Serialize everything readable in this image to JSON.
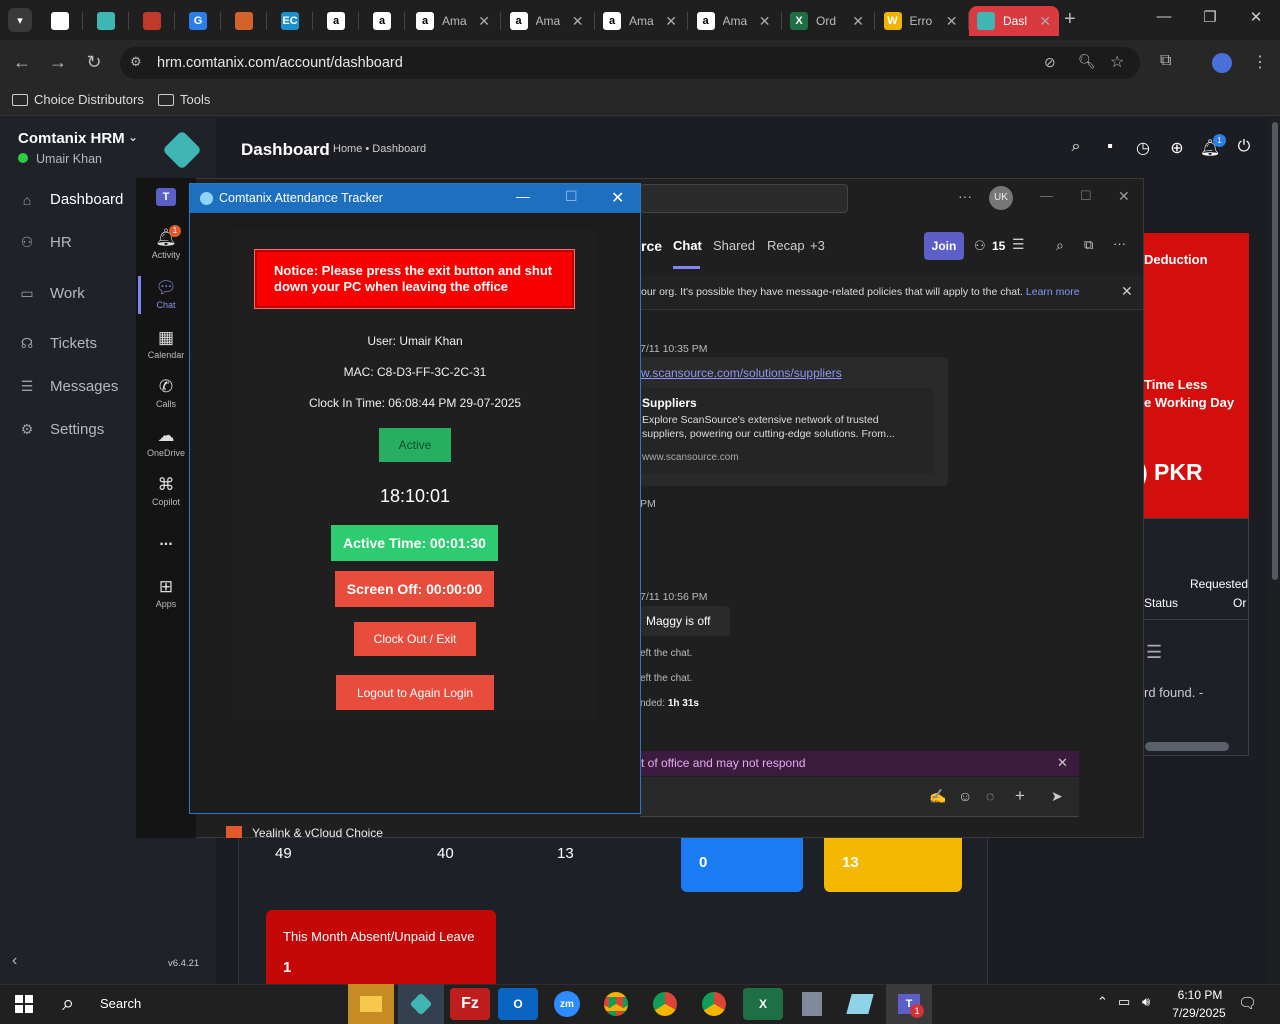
{
  "browser": {
    "tabs": [
      {
        "title": "",
        "icon": "circle-logo-icon",
        "color": "#ffffff"
      },
      {
        "title": "",
        "icon": "comtanix-icon",
        "color": "#3fb6b3"
      },
      {
        "title": "",
        "icon": "d-and-h-icon",
        "color": "#c0392b"
      },
      {
        "title": "",
        "icon": "g-logo-icon",
        "color": "#2b7de9"
      },
      {
        "title": "",
        "icon": "box-icon",
        "color": "#d4622b"
      },
      {
        "title": "",
        "icon": "ec-icon",
        "color": "#1e90c8"
      },
      {
        "title": "",
        "icon": "amazon-icon",
        "color": "#ffffff"
      },
      {
        "title": "",
        "icon": "amazon-icon",
        "color": "#ffffff"
      },
      {
        "title": "Ama",
        "icon": "amazon-icon",
        "color": "#ffffff"
      },
      {
        "title": "Ama",
        "icon": "amazon-icon",
        "color": "#ffffff"
      },
      {
        "title": "Ama",
        "icon": "amazon-icon",
        "color": "#ffffff"
      },
      {
        "title": "Ama",
        "icon": "amazon-icon",
        "color": "#ffffff"
      },
      {
        "title": "Ord",
        "icon": "excel-icon",
        "color": "#1d7044"
      },
      {
        "title": "Erro",
        "icon": "w-icon",
        "color": "#f0b400"
      },
      {
        "title": "Dasl",
        "icon": "comtanix-icon",
        "color": "#3fb6b3"
      }
    ],
    "url": "hrm.comtanix.com/account/dashboard",
    "bookmarks": [
      "Choice Distributors",
      "Tools"
    ]
  },
  "hrm": {
    "org": "Comtanix HRM",
    "user": "Umair Khan",
    "nav": [
      "Dashboard",
      "HR",
      "Work",
      "Tickets",
      "Messages",
      "Settings"
    ],
    "page_title": "Dashboard",
    "breadcrumb": "Home • Dashboard",
    "notification_count": "1",
    "version": "v6.4.21",
    "deduction_label": "Deduction",
    "time_less_label": "Time Less",
    "working_day_label": "e Working Day",
    "pkr_value": ") PKR",
    "table_head_requested": "Requested",
    "table_head_status": "Status",
    "table_head_or": "Or",
    "no_record": "rd found. -",
    "stats": [
      "49",
      "40",
      "13"
    ],
    "blue_card_value": "0",
    "yellow_card_value": "13",
    "absent_title": "This Month Absent/Unpaid Leave",
    "absent_value": "1"
  },
  "teams": {
    "rail": [
      {
        "label": "Activity",
        "icon": "bell-icon",
        "badge": "1"
      },
      {
        "label": "Chat",
        "icon": "chat-icon"
      },
      {
        "label": "Calendar",
        "icon": "calendar-icon"
      },
      {
        "label": "Calls",
        "icon": "phone-icon"
      },
      {
        "label": "OneDrive",
        "icon": "cloud-icon"
      },
      {
        "label": "Copilot",
        "icon": "copilot-icon"
      },
      {
        "label": "...",
        "icon": "more-icon"
      },
      {
        "label": "Apps",
        "icon": "apps-icon"
      }
    ],
    "chat_name_partial": "rce",
    "tabs": [
      "Chat",
      "Shared",
      "Recap",
      "+3"
    ],
    "join_label": "Join",
    "participants": "15",
    "avatar_initials": "UK",
    "banner_text": "our org. It's possible they have message-related policies that will apply to the chat.",
    "banner_link": "Learn more",
    "msg1_time": "7/11 10:35 PM",
    "msg1_link": "w.scansource.com/solutions/suppliers",
    "card_title": "Suppliers",
    "card_desc": "Explore ScanSource's extensive network of trusted suppliers, powering our cutting-edge solutions. From...",
    "card_domain": "www.scansource.com",
    "pm_label": "PM",
    "msg2_time": "7/11 10:56 PM",
    "msg2_text": "Maggy is off",
    "left1": "eft the chat.",
    "left2": "eft the chat.",
    "ended_prefix": "nded:",
    "ended_value": "1h 31s",
    "ooo_text": "t of office and may not respond",
    "sidebar_item": "Yealink & vCloud Choice"
  },
  "tracker": {
    "title": "Comtanix Attendance Tracker",
    "notice": "Notice: Please press the exit button and shut down your PC when leaving the office",
    "user_line": "User: Umair Khan",
    "mac_line": "MAC: C8-D3-FF-3C-2C-31",
    "clock_in_line": "Clock In Time: 06:08:44 PM 29-07-2025",
    "status_label": "Active",
    "clock": "18:10:01",
    "active_time": "Active Time: 00:01:30",
    "screen_off": "Screen Off: 00:00:00",
    "clock_out": "Clock Out / Exit",
    "logout": "Logout to Again Login"
  },
  "taskbar": {
    "search": "Search",
    "time": "6:10 PM",
    "date": "7/29/2025",
    "teams_badge": "1"
  }
}
